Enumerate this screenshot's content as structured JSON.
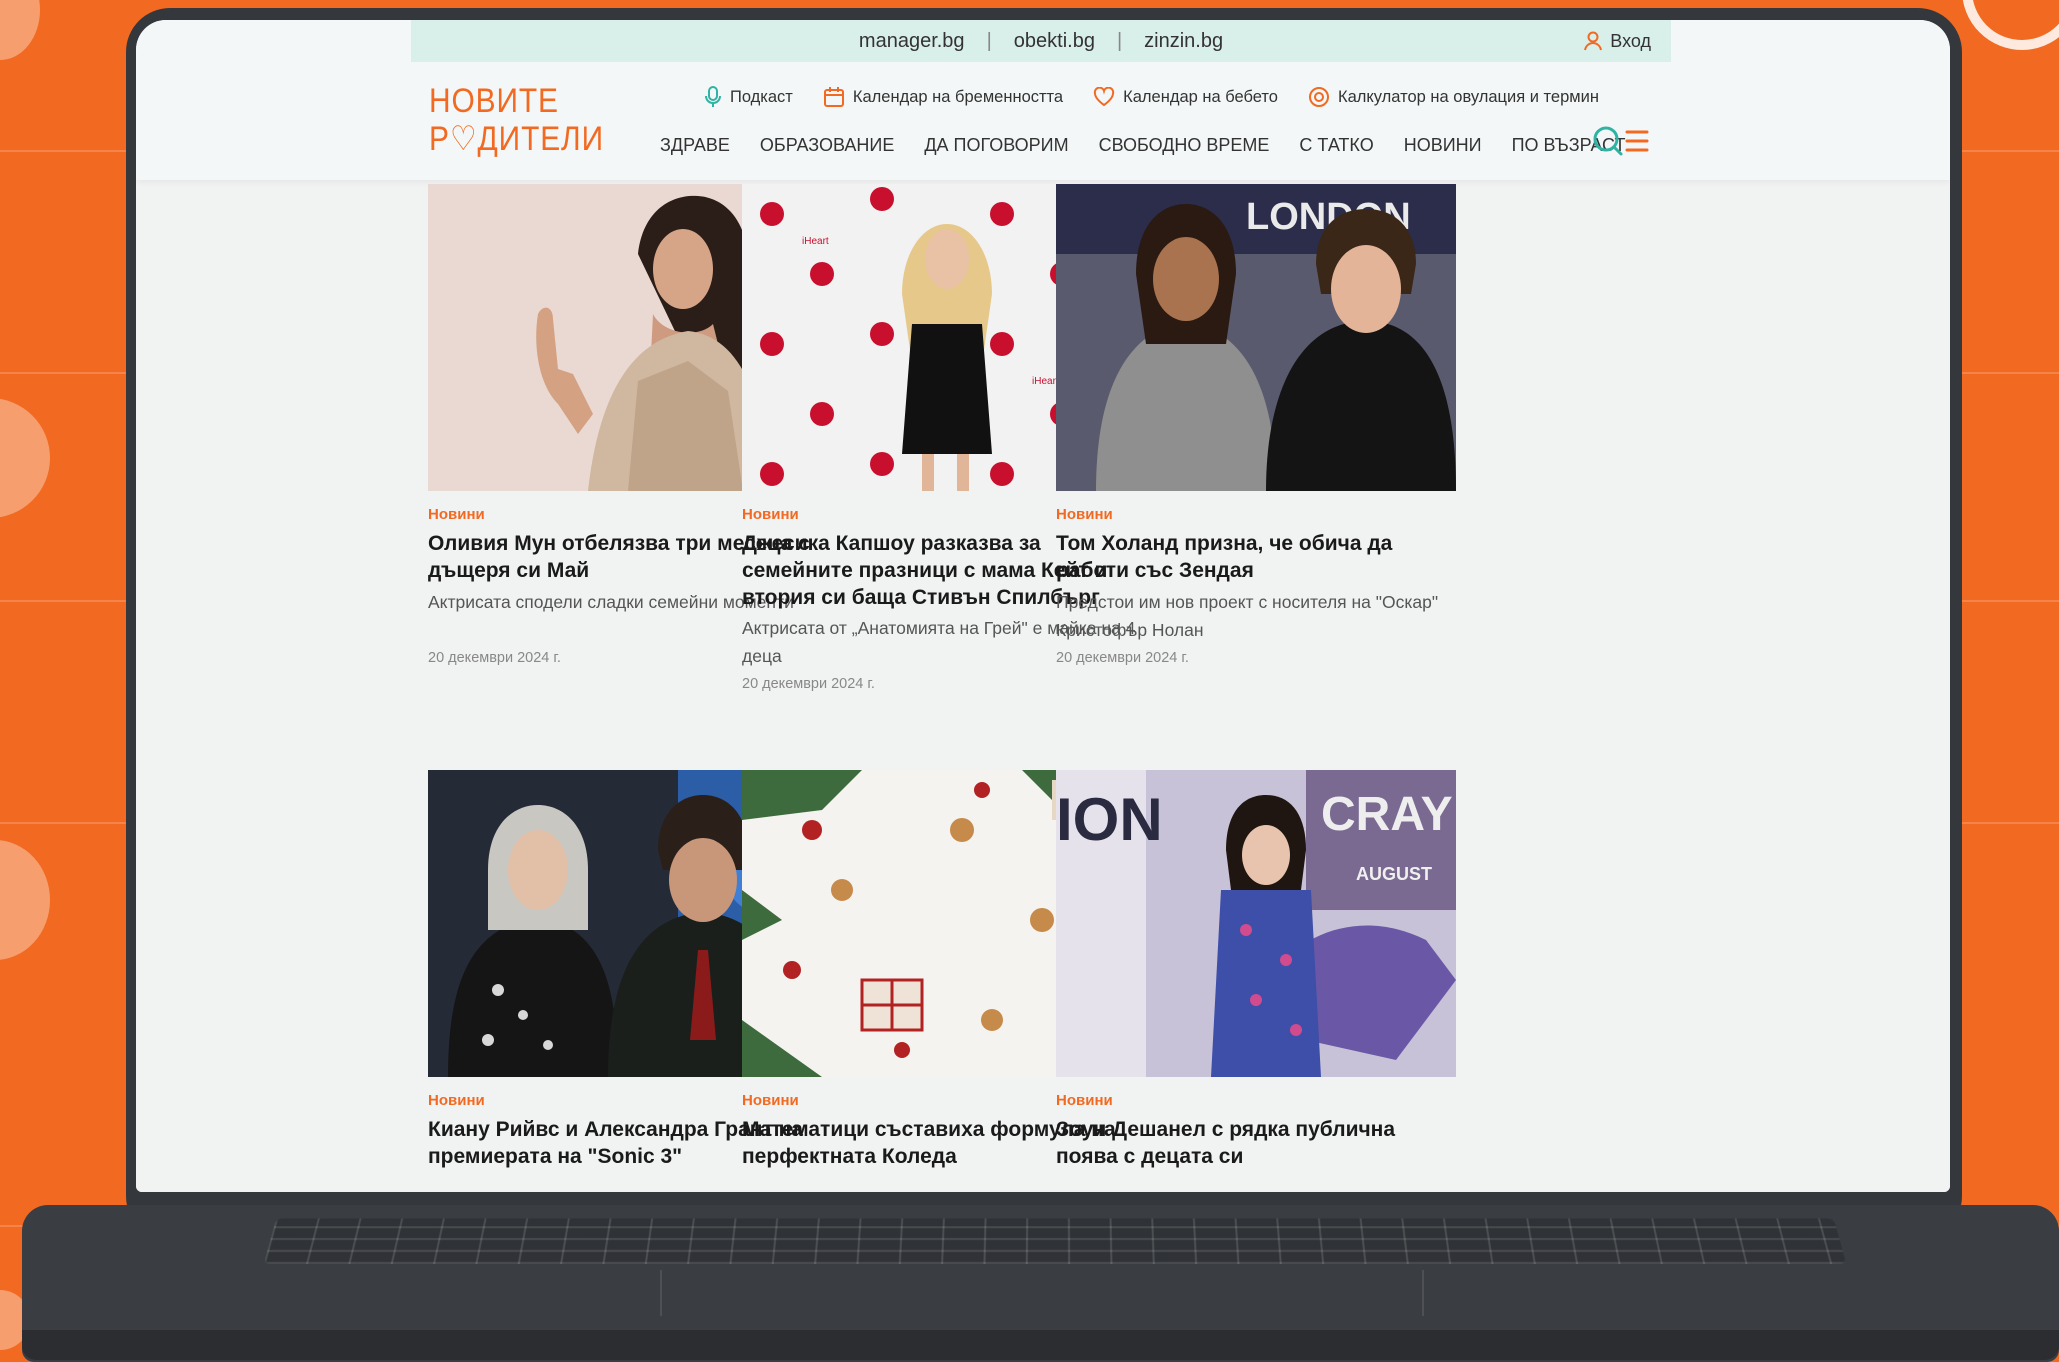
{
  "topbar": {
    "sites": [
      "manager.bg",
      "obekti.bg",
      "zinzin.bg"
    ],
    "separator": "|",
    "login_label": "Вход"
  },
  "logo": {
    "line1": "НОВИТЕ",
    "line2": "Р♡ДИТЕЛИ"
  },
  "quick_links": [
    {
      "label": "Подкаст",
      "icon": "microphone-icon"
    },
    {
      "label": "Календар на бременността",
      "icon": "calendar-icon"
    },
    {
      "label": "Календар на бебето",
      "icon": "heart-icon"
    },
    {
      "label": "Калкулатор на овулация и термин",
      "icon": "target-icon"
    }
  ],
  "nav": [
    "ЗДРАВЕ",
    "ОБРАЗОВАНИЕ",
    "ДА ПОГОВОРИМ",
    "СВОБОДНО ВРЕМЕ",
    "С ТАТКО",
    "НОВИНИ",
    "ПО ВЪЗРАСТ"
  ],
  "colors": {
    "accent": "#f26a21",
    "topbar": "#d9efea",
    "teal": "#2fb3a3"
  },
  "articles": [
    {
      "category": "Новини",
      "title": "Оливия Мун отбелязва три месеца с дъщеря си Май",
      "desc": "Актрисата сподели сладки семейни моменти",
      "date": "20 декември 2024 г."
    },
    {
      "category": "Новини",
      "title": "Джесика Капшоу разказва за семейните празници с мама Кейт и втория си баща Стивън Спилбърг",
      "desc": "Актрисата от „Анатомията на Грей\" е майка на 4 деца",
      "date": "20 декември 2024 г."
    },
    {
      "category": "Новини",
      "title": "Том Холанд призна, че обича да работи със Зендая",
      "desc": "Предстои им нов проект с носителя на \"Оскар\" Кристофър Нолан",
      "date": "20 декември 2024 г."
    },
    {
      "category": "Новини",
      "title": "Киану Рийвс и Александра Грант на премиерата на \"Sonic 3\""
    },
    {
      "category": "Новини",
      "title": "Математици съставиха формула на перфектната Коледа"
    },
    {
      "category": "Новини",
      "title": "Зоуи Дешанел с рядка публична поява с децата си"
    }
  ],
  "image_texts": {
    "london": "LONDON",
    "iheart": "iHeart",
    "ion": "ION",
    "cray": "CRAY",
    "august": "AUGUST"
  }
}
